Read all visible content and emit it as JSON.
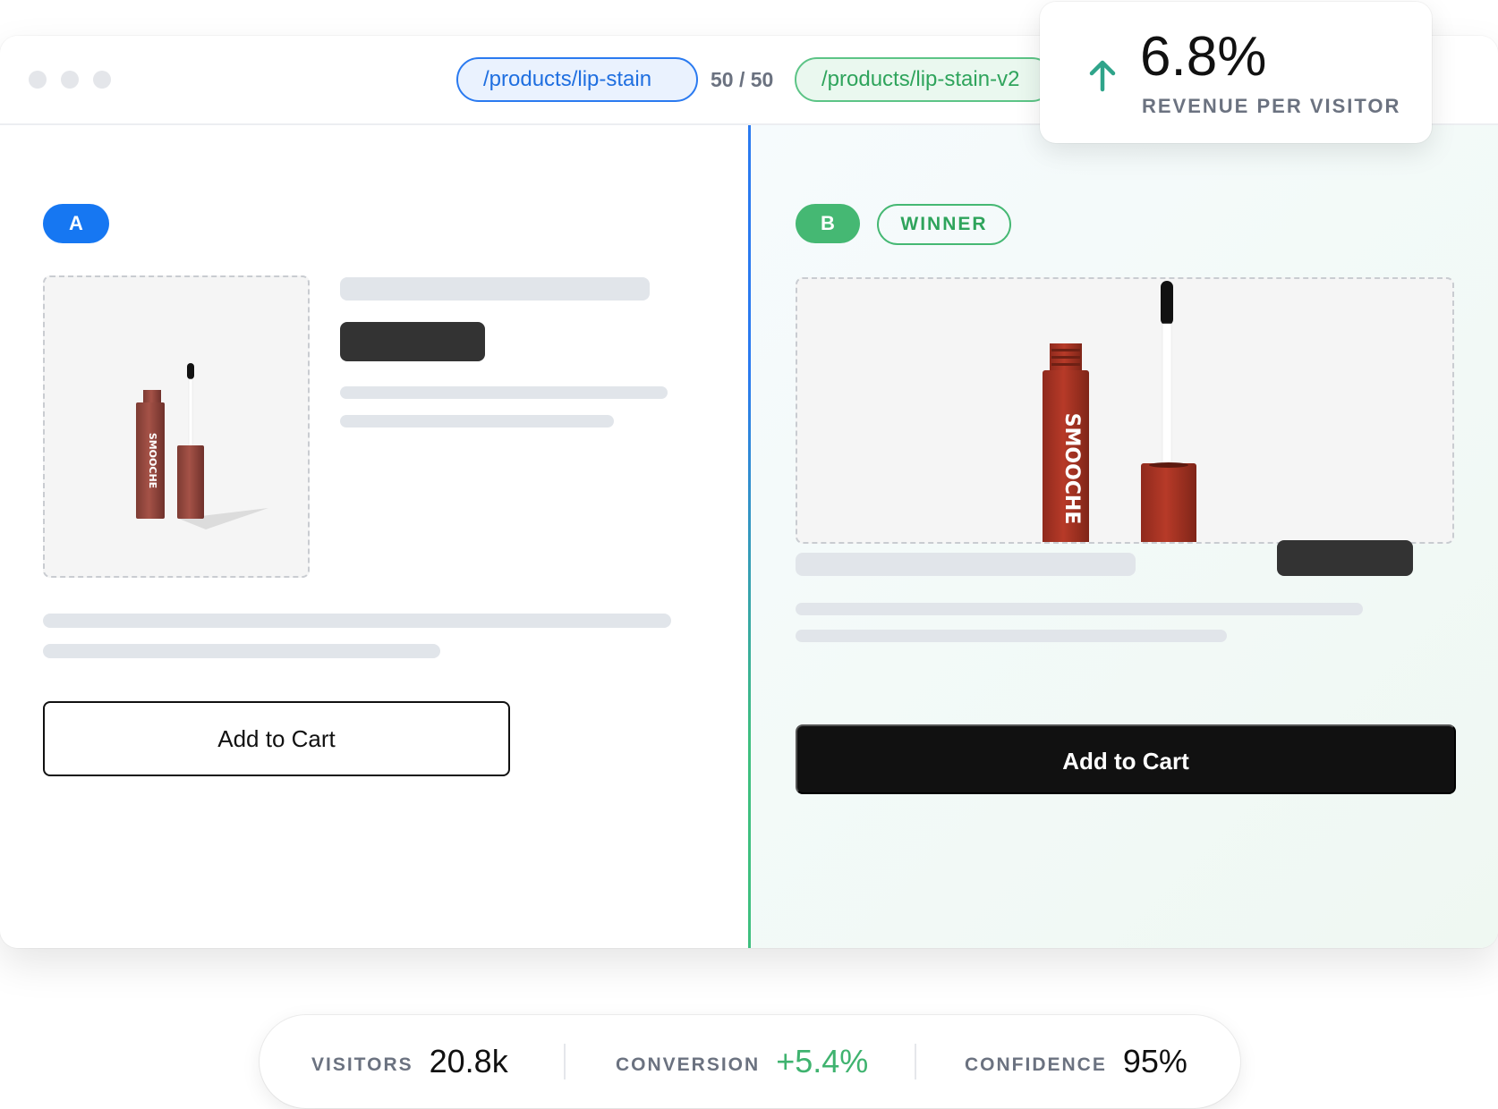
{
  "toolbar": {
    "url_a": "/products/lip-stain",
    "split": "50 / 50",
    "url_b": "/products/lip-stain-v2"
  },
  "variant_a": {
    "badge": "A",
    "cta_label": "Add to Cart",
    "brand": "SMOOCHE"
  },
  "variant_b": {
    "badge": "B",
    "winner_label": "WINNER",
    "cta_label": "Add to Cart",
    "brand": "SMOOCHE"
  },
  "metric": {
    "value": "6.8%",
    "label": "REVENUE PER VISITOR",
    "trend_icon": "arrow-up-icon",
    "trend_color": "#2fa48a"
  },
  "stats": [
    {
      "label": "VISITORS",
      "value": "20.8k"
    },
    {
      "label": "CONVERSION",
      "value": "+5.4%"
    },
    {
      "label": "CONFIDENCE",
      "value": "95%"
    }
  ],
  "colors": {
    "variant_a": "#1677f2",
    "variant_b": "#45b873",
    "product": "#9b3a2e"
  }
}
